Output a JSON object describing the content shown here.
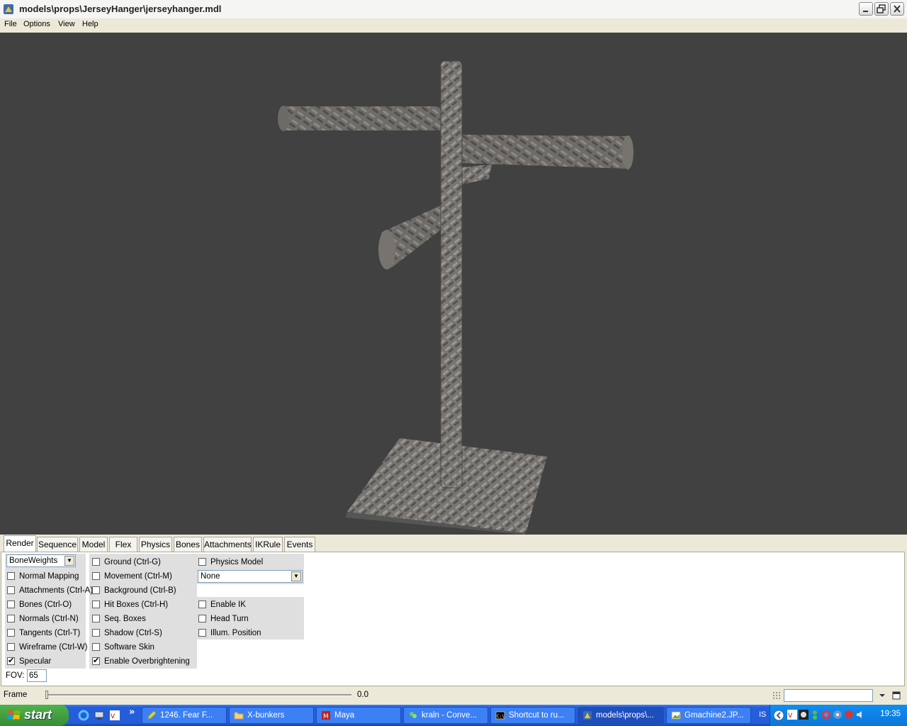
{
  "window": {
    "title": "models\\props\\JerseyHanger\\jerseyhanger.mdl"
  },
  "menu": [
    "File",
    "Options",
    "View",
    "Help"
  ],
  "tabs": [
    "Render",
    "Sequence",
    "Model",
    "Flex",
    "Physics",
    "Bones",
    "Attachments",
    "IKRule",
    "Events"
  ],
  "render": {
    "mode_select": "BoneWeights",
    "col1": [
      {
        "label": "Normal Mapping",
        "checked": false
      },
      {
        "label": "Attachments (Ctrl-A)",
        "checked": false
      },
      {
        "label": "Bones (Ctrl-O)",
        "checked": false
      },
      {
        "label": "Normals (Ctrl-N)",
        "checked": false
      },
      {
        "label": "Tangents (Ctrl-T)",
        "checked": false
      },
      {
        "label": "Wireframe (Ctrl-W)",
        "checked": false
      },
      {
        "label": "Specular",
        "checked": true
      }
    ],
    "col2": [
      {
        "label": "Ground (Ctrl-G)",
        "checked": false
      },
      {
        "label": "Movement (Ctrl-M)",
        "checked": false
      },
      {
        "label": "Background (Ctrl-B)",
        "checked": false
      },
      {
        "label": "Hit Boxes (Ctrl-H)",
        "checked": false
      },
      {
        "label": "Seq. Boxes",
        "checked": false
      },
      {
        "label": "Shadow (Ctrl-S)",
        "checked": false
      },
      {
        "label": "Software Skin",
        "checked": false
      },
      {
        "label": "Enable Overbrightening",
        "checked": true
      }
    ],
    "physics_model": {
      "label": "Physics Model",
      "checked": false
    },
    "physics_select": "None",
    "col3": [
      {
        "label": "Enable IK",
        "checked": false
      },
      {
        "label": "Head Turn",
        "checked": false
      },
      {
        "label": "Illum. Position",
        "checked": false
      }
    ],
    "fov_label": "FOV:",
    "fov_value": "65"
  },
  "frame": {
    "label": "Frame",
    "value": "0.0"
  },
  "taskbar": {
    "start_label": "start",
    "tasks": [
      {
        "label": "1246. Fear F...",
        "icon": "pencil-icon",
        "active": false
      },
      {
        "label": "X-bunkers",
        "icon": "folder-icon",
        "active": false
      },
      {
        "label": "Maya",
        "icon": "maya-icon",
        "active": false
      },
      {
        "label": "kraln - Conve...",
        "icon": "chat-icon",
        "active": false
      },
      {
        "label": "Shortcut to ru...",
        "icon": "console-icon",
        "active": false
      },
      {
        "label": "models\\props\\...",
        "icon": "hlmv-icon",
        "active": true
      },
      {
        "label": "Gmachine2.JP...",
        "icon": "image-icon",
        "active": false
      }
    ],
    "lang": "IS",
    "clock": "19:35"
  }
}
